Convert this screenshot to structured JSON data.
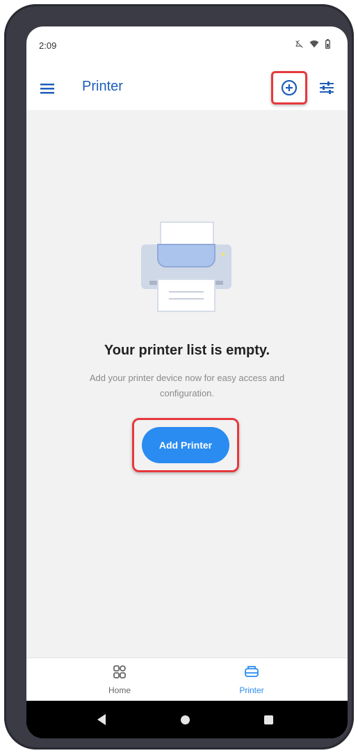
{
  "status_bar": {
    "time": "2:09",
    "icons": [
      "notifications-off-icon",
      "wifi-icon",
      "battery-icon"
    ]
  },
  "app_bar": {
    "title": "Printer",
    "left_icon": "menu-icon",
    "right_icons": [
      "add-circle-icon",
      "tune-icon"
    ]
  },
  "empty_state": {
    "illustration": "printer-illustration",
    "title": "Your printer list is empty.",
    "description": "Add your printer device now for easy access and configuration.",
    "button_label": "Add Printer"
  },
  "bottom_nav": {
    "items": [
      {
        "label": "Home",
        "icon": "grid-icon",
        "active": false
      },
      {
        "label": "Printer",
        "icon": "printer-icon",
        "active": true
      }
    ]
  },
  "system_nav": [
    "back-icon",
    "home-circle-icon",
    "recents-square-icon"
  ],
  "colors": {
    "accent": "#1e5db8",
    "button": "#2a8cf1",
    "highlight": "#e5393d",
    "background": "#f2f2f2"
  }
}
